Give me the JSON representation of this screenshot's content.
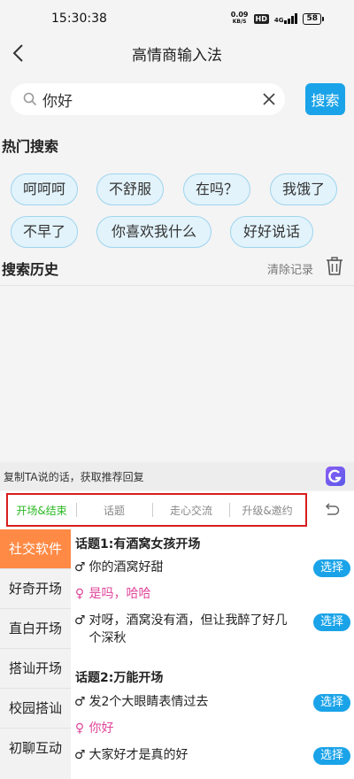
{
  "status_bar": {
    "time": "15:30:38",
    "net_speed_value": "0.09",
    "net_speed_unit": "KB/S",
    "hd": "HD",
    "network": "4G",
    "battery": "58"
  },
  "nav": {
    "title": "高情商输入法"
  },
  "search": {
    "value": "你好",
    "button_label": "搜索"
  },
  "hot_search": {
    "title": "热门搜索",
    "tags": [
      "呵呵呵",
      "不舒服",
      "在吗？",
      "我饿了",
      "不早了",
      "你喜欢我什么",
      "好好说话"
    ]
  },
  "history": {
    "title": "搜索历史",
    "clear_label": "清除记录"
  },
  "copy_hint": {
    "text": "复制TA说的话，获取推荐回复"
  },
  "tabs": [
    {
      "label": "开场&结束",
      "active": true
    },
    {
      "label": "话题",
      "active": false
    },
    {
      "label": "走心交流",
      "active": false
    },
    {
      "label": "升级&邀约",
      "active": false
    }
  ],
  "sidebar": {
    "items": [
      {
        "label": "社交软件",
        "active": true
      },
      {
        "label": "好奇开场",
        "active": false
      },
      {
        "label": "直白开场",
        "active": false
      },
      {
        "label": "搭讪开场",
        "active": false
      },
      {
        "label": "校园搭讪",
        "active": false
      },
      {
        "label": "初聊互动",
        "active": false
      }
    ]
  },
  "topics": [
    {
      "title": "话题1:有酒窝女孩开场",
      "lines": [
        {
          "gender": "male",
          "symbol": "♂",
          "text": "你的酒窝好甜",
          "select": true
        },
        {
          "gender": "female",
          "symbol": "♀",
          "text": "是吗，哈哈",
          "select": false
        },
        {
          "gender": "male",
          "symbol": "♂",
          "text": "对呀，酒窝没有酒，但让我醉了好几",
          "text2": "个深秋",
          "select": true
        }
      ]
    },
    {
      "title": "话题2:万能开场",
      "lines": [
        {
          "gender": "male",
          "symbol": "♂",
          "text": "发2个大眼睛表情过去",
          "select": true
        },
        {
          "gender": "female",
          "symbol": "♀",
          "text": "你好",
          "select": false
        },
        {
          "gender": "male",
          "symbol": "♂",
          "text": "大家好才是真的好",
          "select": true
        }
      ]
    }
  ],
  "select_label": "选择",
  "colors": {
    "accent": "#1aa3e8",
    "active_tab": "#28b820",
    "sidebar_active": "#ff8a45",
    "female": "#e0459a",
    "highlight_box": "#d81e1e"
  }
}
